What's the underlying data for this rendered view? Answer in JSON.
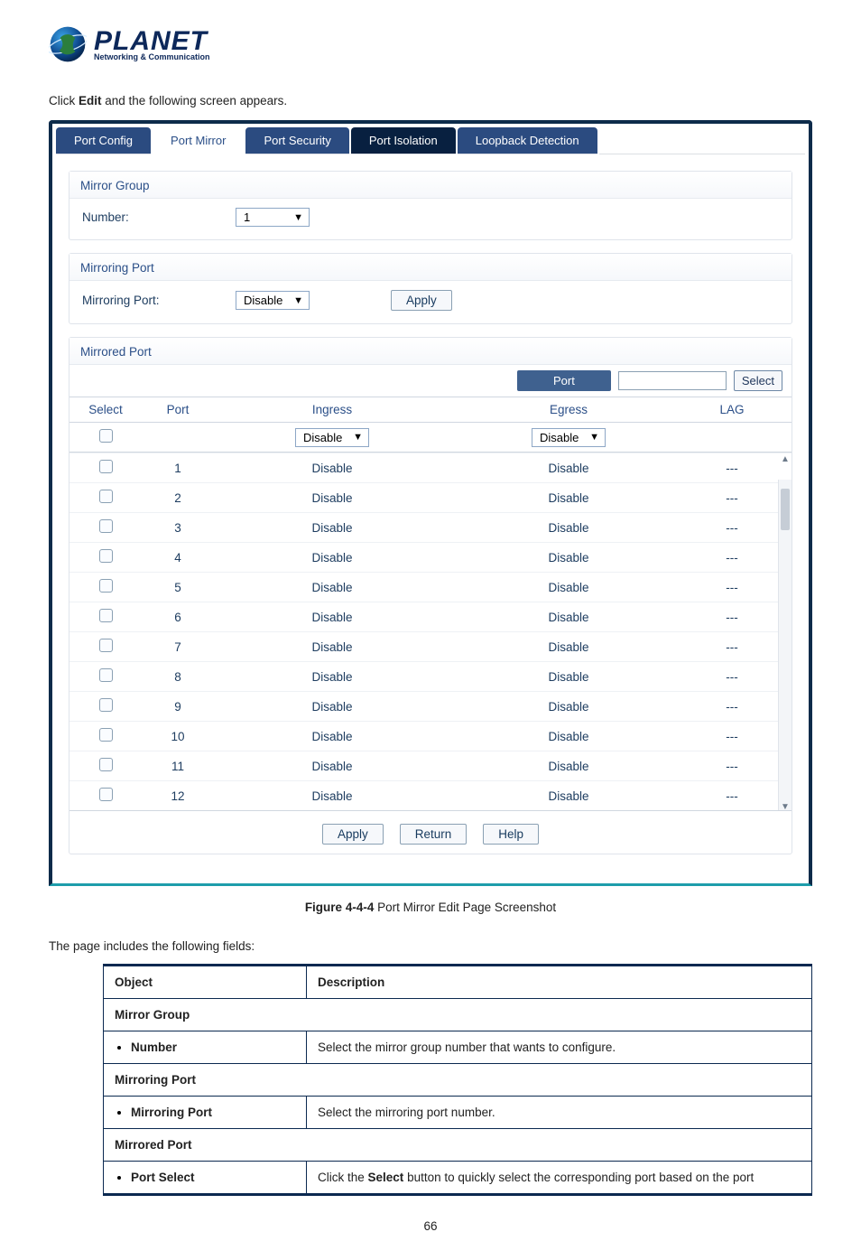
{
  "logo": {
    "word": "PLANET",
    "tagline": "Networking & Communication"
  },
  "lead": {
    "pre": "Click ",
    "bold": "Edit",
    "post": " and the following screen appears."
  },
  "tabs": [
    {
      "label": "Port Config",
      "cls": "tab"
    },
    {
      "label": "Port Mirror",
      "cls": "tab active"
    },
    {
      "label": "Port Security",
      "cls": "tab"
    },
    {
      "label": "Port Isolation",
      "cls": "tab alt"
    },
    {
      "label": "Loopback Detection",
      "cls": "tab"
    }
  ],
  "mirrorGroup": {
    "title": "Mirror Group",
    "numberLabel": "Number:",
    "numberValue": "1"
  },
  "mirroringPort": {
    "title": "Mirroring Port",
    "label": "Mirroring Port:",
    "value": "Disable",
    "apply": "Apply"
  },
  "mirroredPort": {
    "title": "Mirrored Port",
    "portLabel": "Port",
    "selectBtn": "Select",
    "headers": {
      "select": "Select",
      "port": "Port",
      "ingress": "Ingress",
      "egress": "Egress",
      "lag": "LAG"
    },
    "filterIngress": "Disable",
    "filterEgress": "Disable",
    "rows": [
      {
        "port": "1",
        "ingress": "Disable",
        "egress": "Disable",
        "lag": "---"
      },
      {
        "port": "2",
        "ingress": "Disable",
        "egress": "Disable",
        "lag": "---"
      },
      {
        "port": "3",
        "ingress": "Disable",
        "egress": "Disable",
        "lag": "---"
      },
      {
        "port": "4",
        "ingress": "Disable",
        "egress": "Disable",
        "lag": "---"
      },
      {
        "port": "5",
        "ingress": "Disable",
        "egress": "Disable",
        "lag": "---"
      },
      {
        "port": "6",
        "ingress": "Disable",
        "egress": "Disable",
        "lag": "---"
      },
      {
        "port": "7",
        "ingress": "Disable",
        "egress": "Disable",
        "lag": "---"
      },
      {
        "port": "8",
        "ingress": "Disable",
        "egress": "Disable",
        "lag": "---"
      },
      {
        "port": "9",
        "ingress": "Disable",
        "egress": "Disable",
        "lag": "---"
      },
      {
        "port": "10",
        "ingress": "Disable",
        "egress": "Disable",
        "lag": "---"
      },
      {
        "port": "11",
        "ingress": "Disable",
        "egress": "Disable",
        "lag": "---"
      },
      {
        "port": "12",
        "ingress": "Disable",
        "egress": "Disable",
        "lag": "---"
      }
    ],
    "actions": {
      "apply": "Apply",
      "return": "Return",
      "help": "Help"
    }
  },
  "caption": {
    "pre": "Figure 4-4-4",
    "post": " Port Mirror Edit Page Screenshot"
  },
  "fieldsIntro": "The page includes the following fields:",
  "fieldsTable": {
    "head": {
      "object": "Object",
      "desc": "Description"
    },
    "sections": [
      {
        "title": "Mirror Group",
        "rows": [
          {
            "obj": "Number",
            "desc": "Select the mirror group number that wants to configure."
          }
        ]
      },
      {
        "title": "Mirroring Port",
        "rows": [
          {
            "obj": "Mirroring Port",
            "desc": "Select the mirroring port number."
          }
        ]
      },
      {
        "title": "Mirrored Port",
        "rows": [
          {
            "obj": "Port Select",
            "desc_pre": "Click the ",
            "desc_bold": "Select",
            "desc_post": " button to quickly select the corresponding port based on the port"
          }
        ]
      }
    ]
  },
  "pageNumber": "66"
}
